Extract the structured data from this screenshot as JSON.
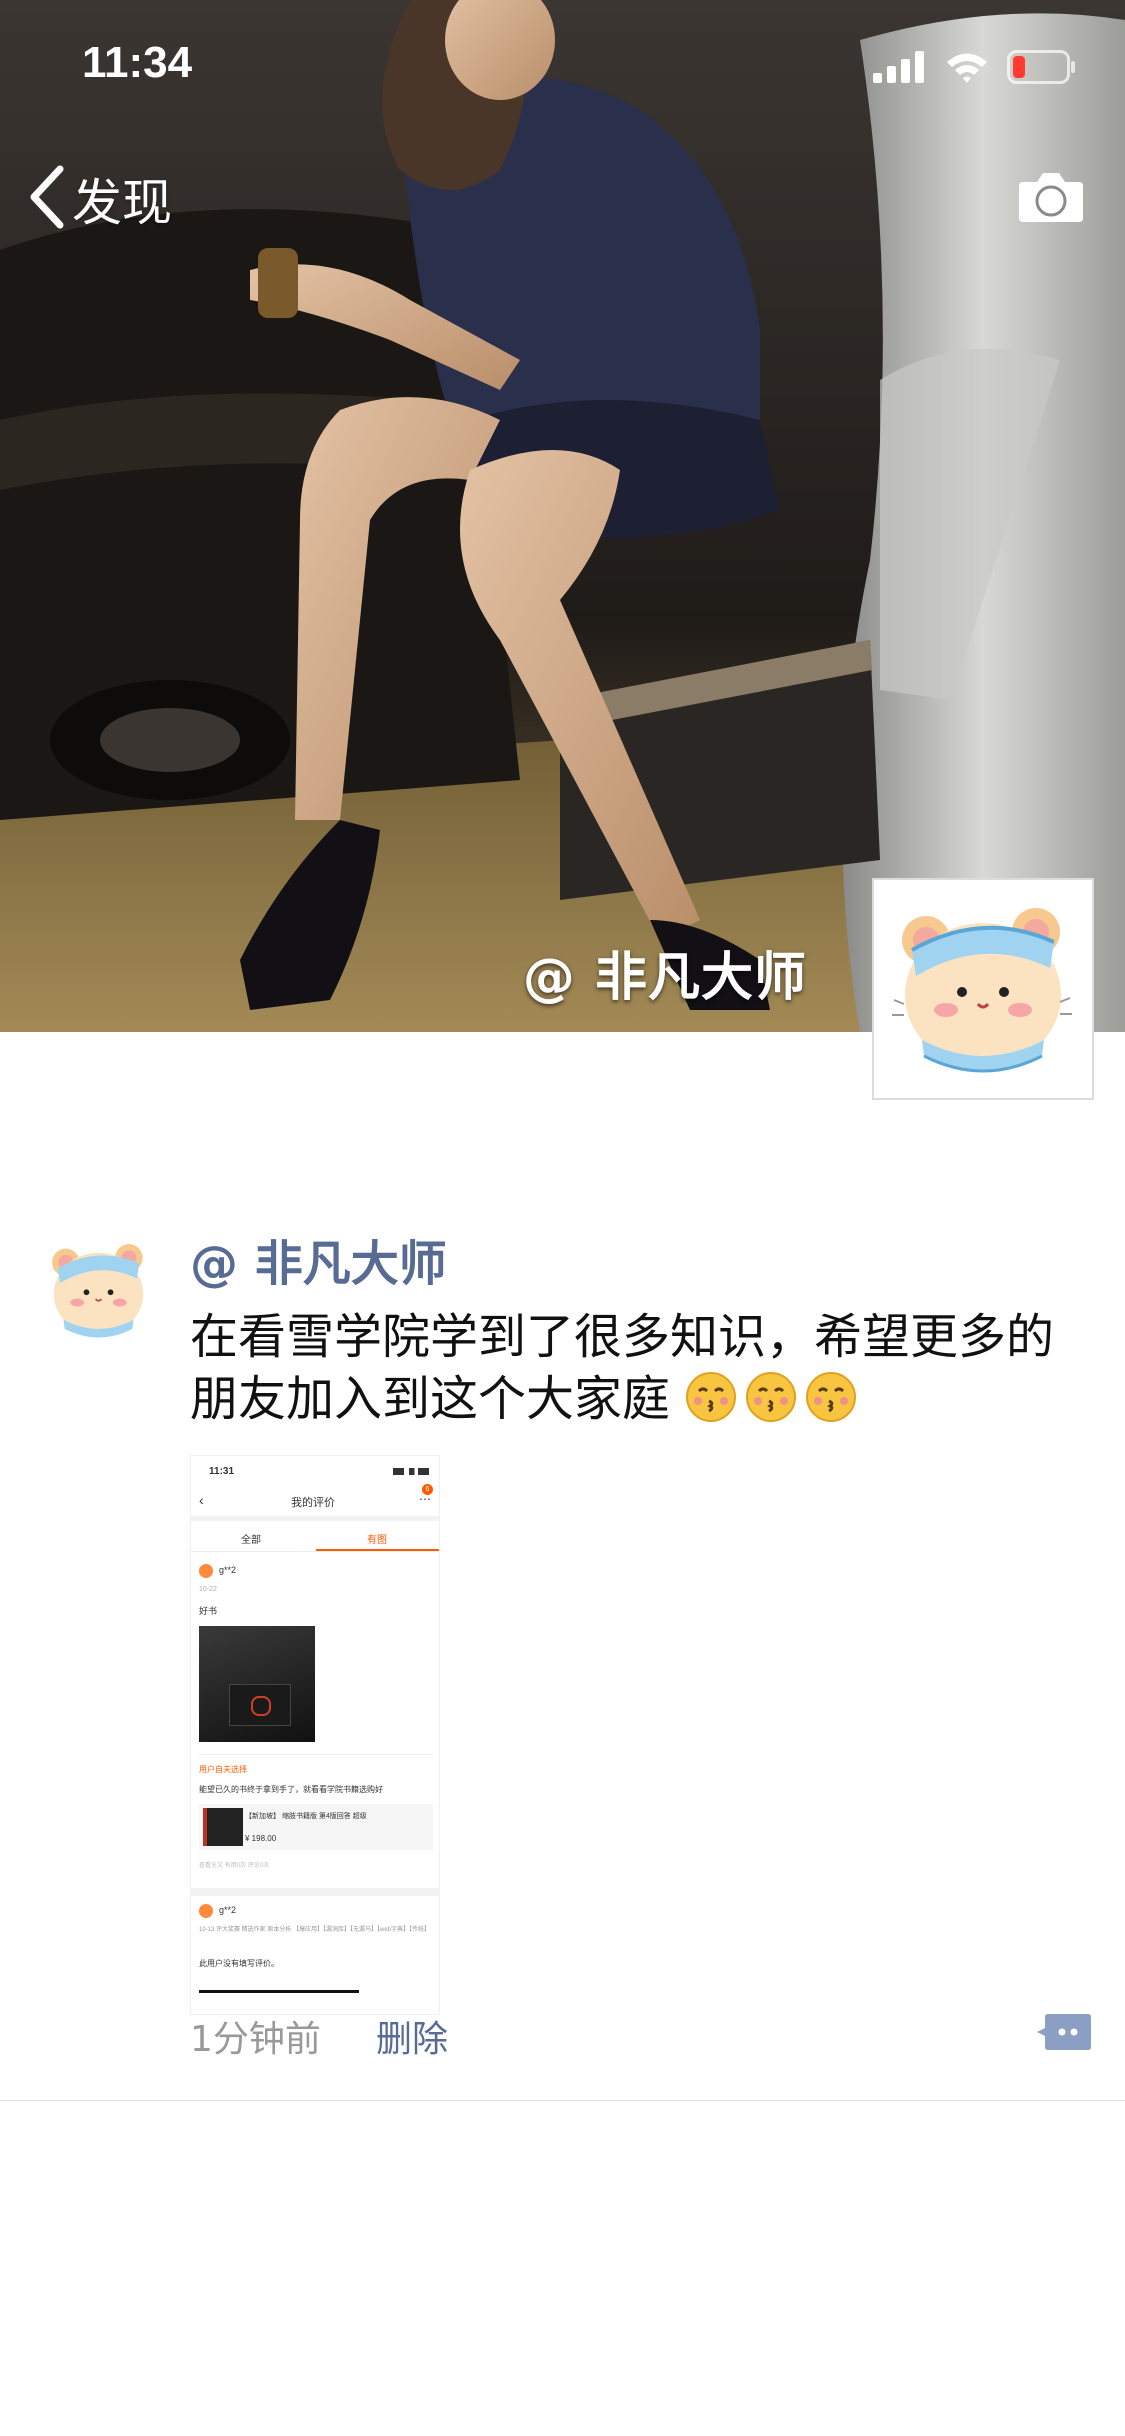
{
  "status_bar": {
    "time": "11:34"
  },
  "nav": {
    "back_label": "发现"
  },
  "cover": {
    "name": "@ 非凡大师"
  },
  "post": {
    "author": "@ 非凡大师",
    "text": "在看雪学院学到了很多知识，希望更多的朋友加入到这个大家庭",
    "emoji_count": 3,
    "time": "1分钟前",
    "delete_label": "删除",
    "image": {
      "time": "11:31",
      "title": "我的评价",
      "badge": "6",
      "tabs": [
        "全部",
        "有图"
      ],
      "user1": "g**2",
      "date1": "10-22",
      "review1": "好书",
      "tag": "用户自夫选择",
      "reply": "能望已久的书终于拿到手了，就看看学院书籍选购好",
      "product": "【新加坡】 缩肢书籍版 第4版回答 超级",
      "price": "¥ 198.00",
      "meta": "查看全文  有用0次  评论0次",
      "user2": "g**2",
      "meta2": "10-13  评大奖赛 精选作家 原本分析 【爆应用】【漏洞库】【无漏马】【web字典】【传统】",
      "note": "此用户没有填写评价。"
    }
  },
  "colors": {
    "link": "#576b95",
    "meta": "#999999",
    "text": "#111111",
    "accent": "#ff5a00"
  }
}
